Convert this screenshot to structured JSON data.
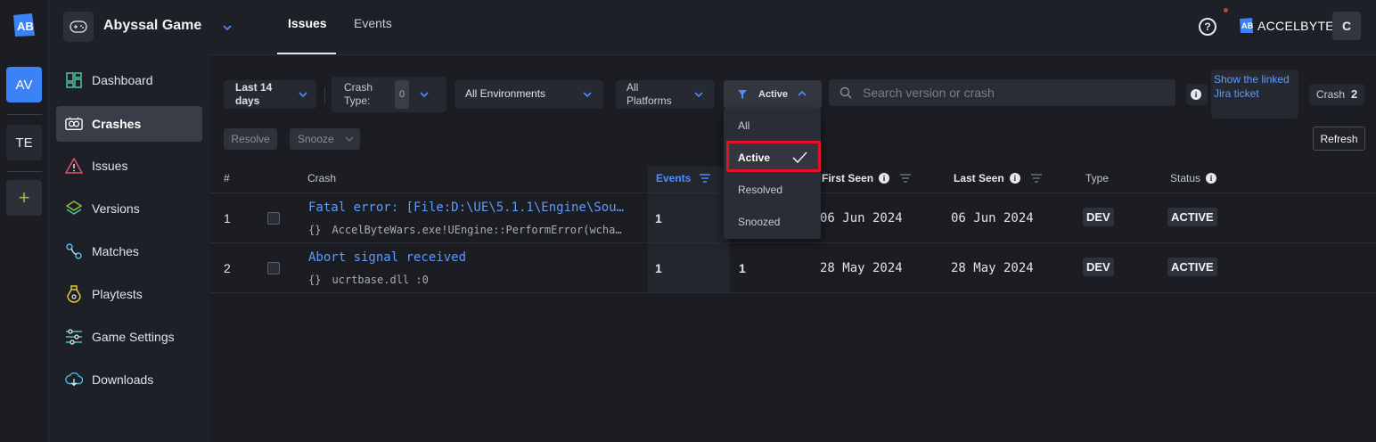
{
  "rail": {
    "logo_icon": "accelbyte-logo-icon",
    "items": [
      {
        "label": "AV"
      },
      {
        "label": "TE"
      },
      {
        "label": "+"
      }
    ]
  },
  "sidebar": {
    "game_name": "Abyssal Game",
    "game_icon": "gamepad-icon",
    "items": [
      {
        "label": "Dashboard",
        "icon": "dashboard-icon"
      },
      {
        "label": "Crashes",
        "icon": "crashes-icon",
        "active": true
      },
      {
        "label": "Issues",
        "icon": "warning-icon"
      },
      {
        "label": "Versions",
        "icon": "layers-icon"
      },
      {
        "label": "Matches",
        "icon": "matches-icon"
      },
      {
        "label": "Playtests",
        "icon": "potion-icon"
      },
      {
        "label": "Game Settings",
        "icon": "sliders-icon"
      },
      {
        "label": "Downloads",
        "icon": "cloud-download-icon"
      }
    ]
  },
  "header": {
    "tabs": [
      {
        "label": "Issues",
        "active": true
      },
      {
        "label": "Events"
      }
    ],
    "help_icon": "?",
    "brand": "ACCELBYTE",
    "avatar": "C"
  },
  "filters": {
    "date_range": "Last 14 days",
    "crash_type_label": "Crash Type:",
    "crash_type_value": "0",
    "environments": "All Environments",
    "platforms": "All Platforms",
    "status": "Active",
    "search_placeholder": "Search version or crash",
    "jira_link": "Show the linked Jira ticket",
    "crash_count_label": "Crash",
    "crash_count": "2"
  },
  "actions": {
    "resolve": "Resolve",
    "snooze": "Snooze",
    "refresh": "Refresh"
  },
  "status_dropdown": {
    "options": [
      "All",
      "Active",
      "Resolved",
      "Snoozed"
    ],
    "selected": "Active"
  },
  "table": {
    "columns": {
      "num": "#",
      "crash": "Crash",
      "events": "Events",
      "users": "",
      "first_seen": "First Seen",
      "last_seen": "Last Seen",
      "type": "Type",
      "status": "Status"
    },
    "rows": [
      {
        "num": "1",
        "title": "Fatal error: [File:D:\\UE\\5.1.1\\Engine\\Sou…",
        "braces": "{}",
        "subtitle": "AccelByteWars.exe!UEngine::PerformError(wcha…",
        "events": "1",
        "users": "",
        "first_seen": "06 Jun 2024",
        "last_seen": "06 Jun 2024",
        "type": "DEV",
        "status": "ACTIVE"
      },
      {
        "num": "2",
        "title": "Abort signal received",
        "braces": "{}",
        "subtitle": "ucrtbase.dll :0",
        "events": "1",
        "users": "1",
        "first_seen": "28 May 2024",
        "last_seen": "28 May 2024",
        "type": "DEV",
        "status": "ACTIVE"
      }
    ]
  },
  "colors": {
    "accent": "#3b82f6",
    "link": "#5b9bff",
    "highlight_border": "#e5112a"
  }
}
